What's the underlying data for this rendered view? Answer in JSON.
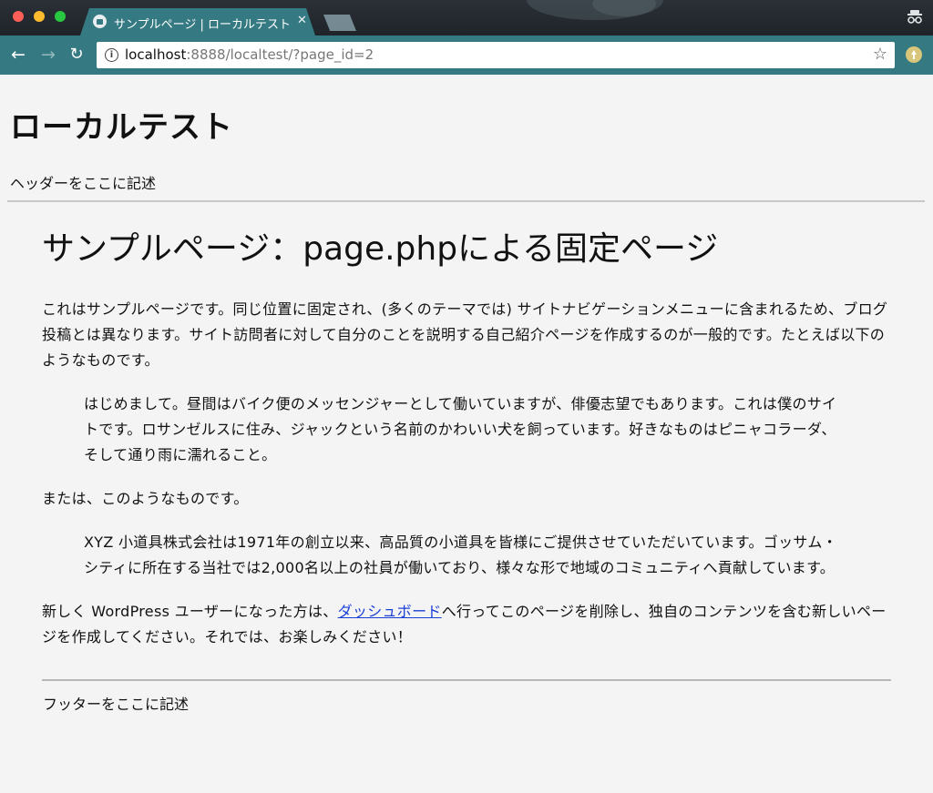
{
  "browser": {
    "tab": {
      "title": "サンプルページ | ローカルテスト",
      "close_glyph": "✕"
    },
    "toolbar": {
      "back_glyph": "←",
      "forward_glyph": "→",
      "reload_glyph": "↻",
      "url_host": "localhost",
      "url_rest": ":8888/localtest/?page_id=2",
      "star_glyph": "☆"
    },
    "icons": {
      "favicon": "wordpress-favicon-icon",
      "incognito": "incognito-icon",
      "extension": "extension-icon",
      "info": "info-icon"
    },
    "colors": {
      "accent": "#357a82",
      "link": "#1a3fd6"
    }
  },
  "page": {
    "site_title": "ローカルテスト",
    "header_text": "ヘッダーをここに記述",
    "heading": "サンプルページ：page.phpによる固定ページ",
    "intro": "これはサンプルページです。同じ位置に固定され、(多くのテーマでは) サイトナビゲーションメニューに含まれるため、ブログ投稿とは異なります。サイト訪問者に対して自分のことを説明する自己紹介ページを作成するのが一般的です。たとえば以下のようなものです。",
    "quote1": "はじめまして。昼間はバイク便のメッセンジャーとして働いていますが、俳優志望でもあります。これは僕のサイトです。ロサンゼルスに住み、ジャックという名前のかわいい犬を飼っています。好きなものはピニャコラーダ、そして通り雨に濡れること。",
    "or_text": "または、このようなものです。",
    "quote2": "XYZ 小道具株式会社は1971年の創立以来、高品質の小道具を皆様にご提供させていただいています。ゴッサム・シティに所在する当社では2,000名以上の社員が働いており、様々な形で地域のコミュニティへ貢献しています。",
    "closing_before": "新しく WordPress ユーザーになった方は、",
    "closing_link": "ダッシュボード",
    "closing_after": "へ行ってこのページを削除し、独自のコンテンツを含む新しいページを作成してください。それでは、お楽しみください！",
    "footer_text": "フッターをここに記述"
  }
}
